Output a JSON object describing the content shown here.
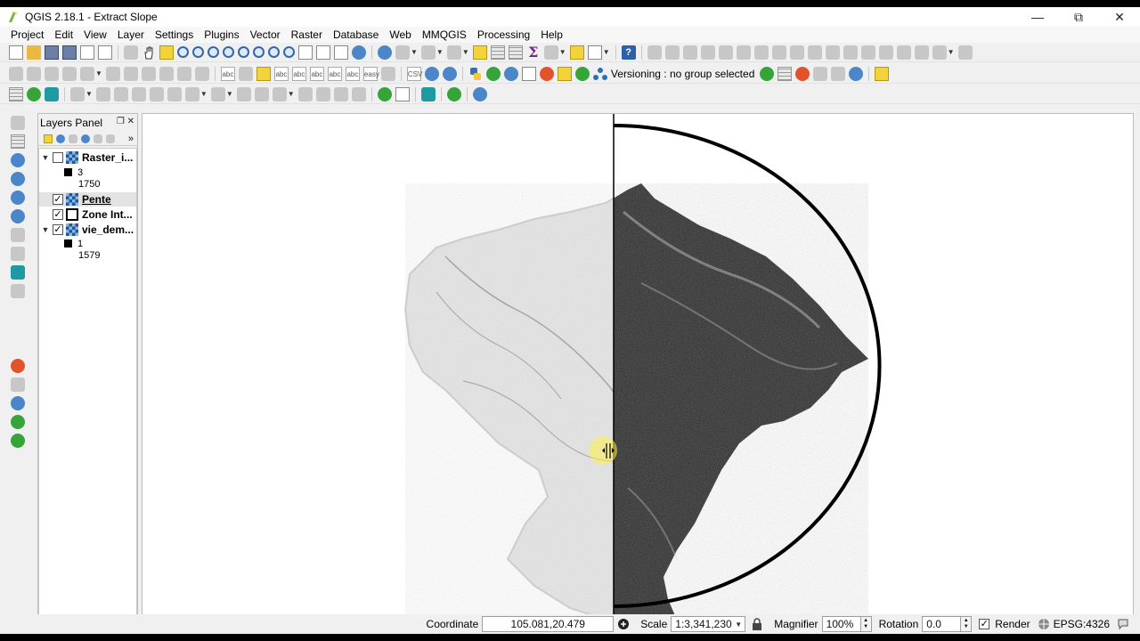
{
  "window": {
    "title": "QGIS 2.18.1 - Extract Slope",
    "minimize": "—",
    "maximize": "⧉",
    "close": "✕"
  },
  "menubar": [
    "Project",
    "Edit",
    "View",
    "Layer",
    "Settings",
    "Plugins",
    "Vector",
    "Raster",
    "Database",
    "Web",
    "MMQGIS",
    "Processing",
    "Help"
  ],
  "toolbar": {
    "versioning_label": "Versioning : no group selected",
    "csv_label": "CSV",
    "sigma": "Σ",
    "help_glyph": "?"
  },
  "layers_panel": {
    "title": "Layers Panel",
    "float_glyph": "❐",
    "close_glyph": "✕",
    "more_glyph": "»",
    "layers": [
      {
        "name": "Raster_i...",
        "checked": false,
        "expanded": true,
        "type": "raster",
        "legend": [
          "3",
          "1750"
        ]
      },
      {
        "name": "Pente",
        "checked": true,
        "expanded": false,
        "type": "raster",
        "selected": true
      },
      {
        "name": "Zone Int...",
        "checked": true,
        "expanded": false,
        "type": "polygon"
      },
      {
        "name": "vie_dem...",
        "checked": true,
        "expanded": true,
        "type": "raster",
        "legend": [
          "1",
          "1579"
        ]
      }
    ]
  },
  "map": {
    "swipe_tool": "magnifier-swipe-lens",
    "colors": {
      "light": "#e9e9e9",
      "dark": "#1a1a1a",
      "swipe_line": "#000000"
    }
  },
  "statusbar": {
    "coordinate_label": "Coordinate",
    "coordinate_value": "105.081,20.479",
    "scale_label": "Scale",
    "scale_value": "1:3,341,230",
    "magnifier_label": "Magnifier",
    "magnifier_value": "100%",
    "rotation_label": "Rotation",
    "rotation_value": "0.0",
    "render_label": "Render",
    "render_checked": true,
    "crs_label": "EPSG:4326"
  }
}
